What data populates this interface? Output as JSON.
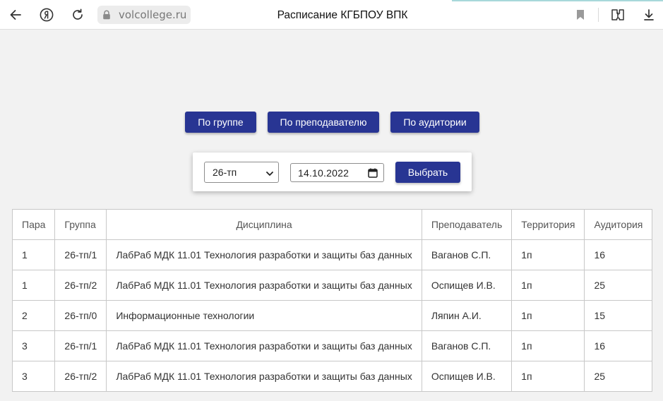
{
  "browser": {
    "url": "volcollege.ru",
    "title": "Расписание КГБПОУ ВПК"
  },
  "modes": {
    "by_group": "По группе",
    "by_teacher": "По преподавателю",
    "by_room": "По аудитории"
  },
  "filter": {
    "group_value": "26-тп",
    "date_value": "14.10.2022",
    "submit_label": "Выбрать"
  },
  "table": {
    "headers": {
      "pair": "Пара",
      "group": "Группа",
      "discipline": "Дисциплина",
      "teacher": "Преподаватель",
      "territory": "Территория",
      "room": "Аудитория"
    },
    "rows": [
      {
        "pair": "1",
        "group": "26-тп/1",
        "discipline": "ЛабРаб МДК 11.01 Технология разработки и защиты баз данных",
        "teacher": "Ваганов С.П.",
        "territory": "1п",
        "room": "16"
      },
      {
        "pair": "1",
        "group": "26-тп/2",
        "discipline": "ЛабРаб МДК 11.01 Технология разработки и защиты баз данных",
        "teacher": "Оспищев И.В.",
        "territory": "1п",
        "room": "25"
      },
      {
        "pair": "2",
        "group": "26-тп/0",
        "discipline": "Информационные технологии",
        "teacher": "Ляпин А.И.",
        "territory": "1п",
        "room": "15"
      },
      {
        "pair": "3",
        "group": "26-тп/1",
        "discipline": "ЛабРаб МДК 11.01 Технология разработки и защиты баз данных",
        "teacher": "Ваганов С.П.",
        "territory": "1п",
        "room": "16"
      },
      {
        "pair": "3",
        "group": "26-тп/2",
        "discipline": "ЛабРаб МДК 11.01 Технология разработки и защиты баз данных",
        "teacher": "Оспищев И.В.",
        "territory": "1п",
        "room": "25"
      }
    ]
  },
  "colors": {
    "accent": "#283593",
    "page_background": "#f2f2f2"
  },
  "icons": [
    "back-arrow-icon",
    "yandex-logo-icon",
    "reload-icon",
    "lock-icon",
    "bookmark-icon",
    "extensions-icon",
    "download-icon",
    "chevron-down-icon",
    "calendar-icon"
  ]
}
